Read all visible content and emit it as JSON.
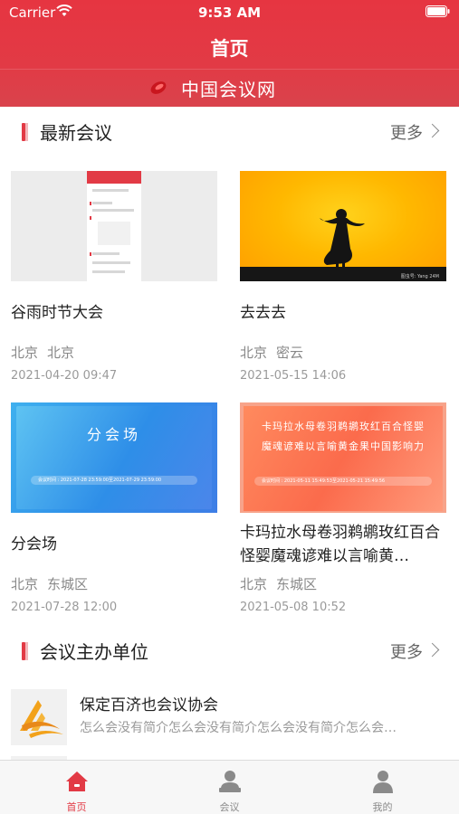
{
  "status_bar": {
    "carrier": "Carrier",
    "time": "9:53 AM"
  },
  "nav": {
    "title": "首页"
  },
  "brand": {
    "name": "中国会议网"
  },
  "colors": {
    "accent": "#e23a45",
    "text_primary": "#222222",
    "text_secondary": "#888888"
  },
  "latest": {
    "title": "最新会议",
    "more": "更多",
    "cards": [
      {
        "title": "谷雨时节大会",
        "city": "北京",
        "district": "北京",
        "date": "2021-04-20 09:47"
      },
      {
        "title": "去去去",
        "city": "北京",
        "district": "密云",
        "date": "2021-05-15 14:06",
        "thumb_caption": "图虫号: Yang 24M"
      },
      {
        "title": "分会场",
        "city": "北京",
        "district": "东城区",
        "date": "2021-07-28 12:00",
        "thumb_title": "分会场",
        "thumb_time": "会议时间 : 2021-07-28 23:59:00至2021-07-29 23:59:00"
      },
      {
        "title": "卡玛拉水母卷羽鹈鹕玫红百合怪婴魔魂谚难以言喻黄…",
        "city": "北京",
        "district": "东城区",
        "date": "2021-05-08 10:52",
        "thumb_line1": "卡玛拉水母卷羽鹈鹕玫红百合怪婴",
        "thumb_line2": "魔魂谚难以言喻黄金果中国影响力",
        "thumb_time": "会议时间 : 2021-05-11 15:49:53至2021-05-21 15:49:56"
      }
    ]
  },
  "organizers": {
    "title": "会议主办单位",
    "more": "更多",
    "items": [
      {
        "name": "保定百济也会议协会",
        "desc": "怎么会没有简介怎么会没有简介怎么会没有简介怎么会…"
      }
    ]
  },
  "tabs": [
    {
      "label": "首页",
      "icon": "home-icon",
      "active": true
    },
    {
      "label": "会议",
      "icon": "meeting-icon",
      "active": false
    },
    {
      "label": "我的",
      "icon": "profile-icon",
      "active": false
    }
  ]
}
